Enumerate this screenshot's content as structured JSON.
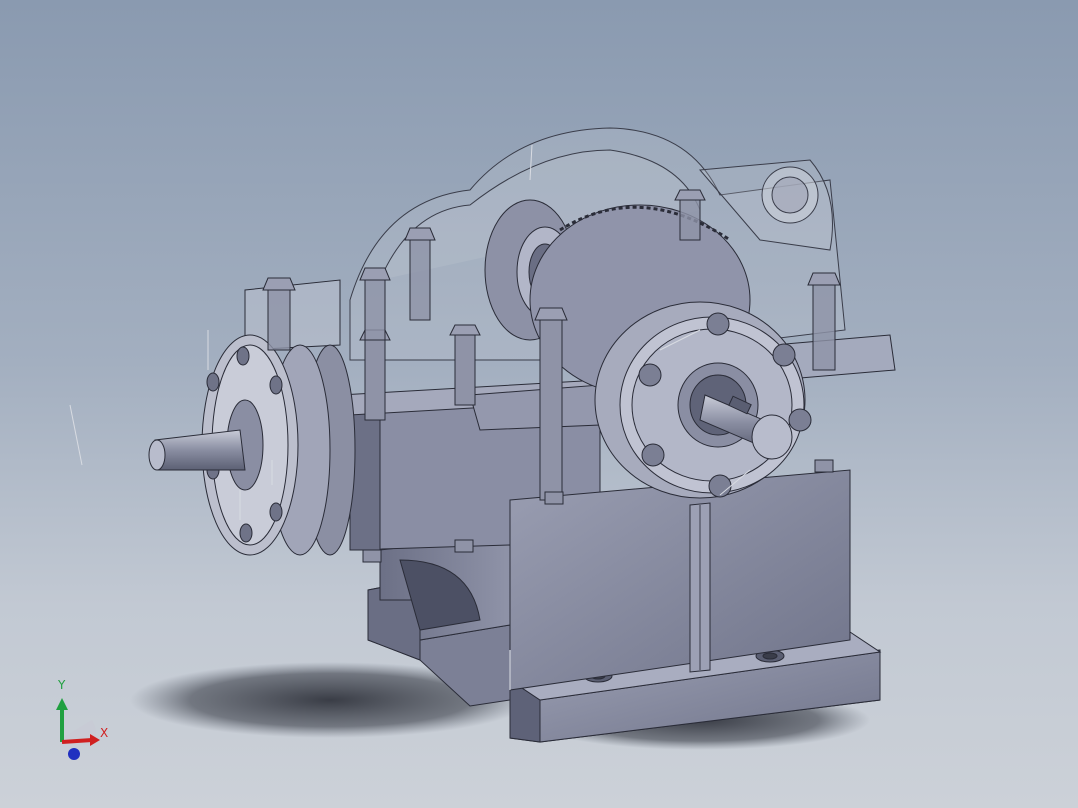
{
  "viewport": {
    "background_top": "#8a9ab0",
    "background_bottom": "#ccd1d8"
  },
  "model": {
    "type": "gearbox-reducer-assembly",
    "body_color": "#8b8fa3",
    "edge_color": "#2a2c38",
    "transparent_cover_color": "#c9ccd6"
  },
  "triad": {
    "x_label": "X",
    "y_label": "Y",
    "x_color": "#d02020",
    "y_color": "#20a040",
    "z_color": "#2030c0"
  }
}
